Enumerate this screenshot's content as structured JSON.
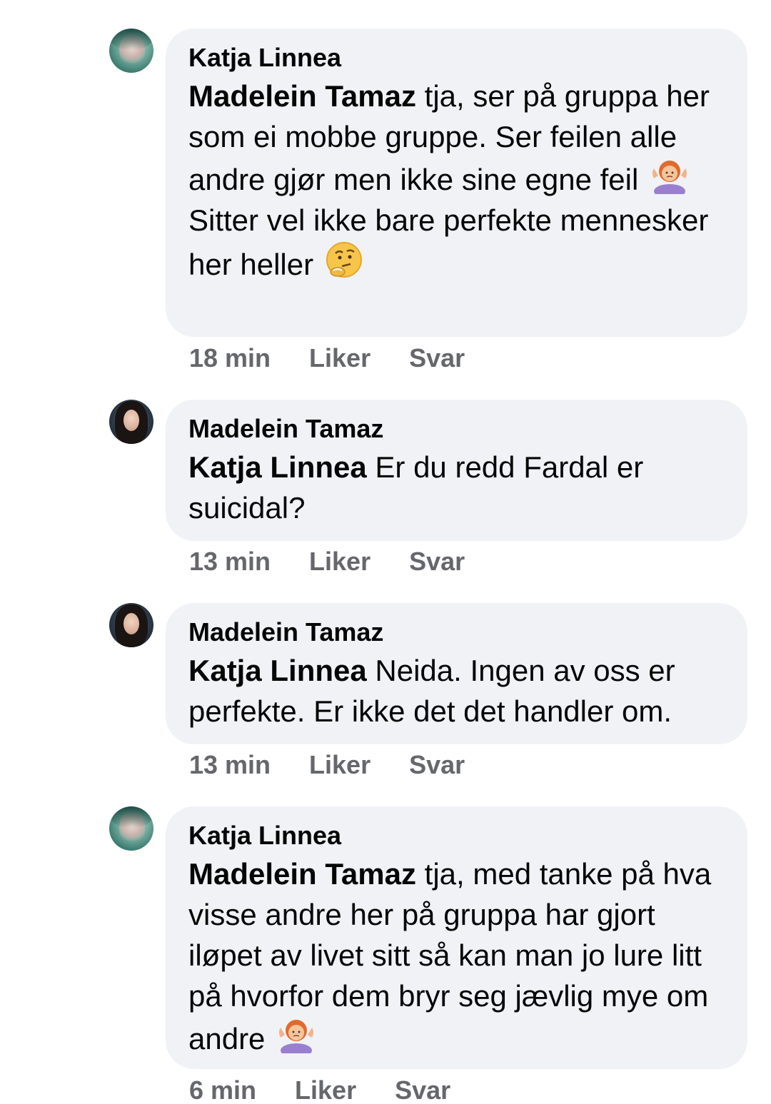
{
  "comments": [
    {
      "author": "Katja Linnea",
      "mention": "Madelein Tamaz",
      "text_line1": " tja, ser på gruppa her som ei mobbe gruppe. Ser feilen alle andre gjør men ikke sine egne feil ",
      "emoji1": "person-shrugging-emoji",
      "text_line2": "Sitter vel ikke bare perfekte mennesker her heller ",
      "emoji2": "thinking-face-emoji",
      "time": "18 min",
      "like_label": "Liker",
      "reply_label": "Svar"
    },
    {
      "author": "Madelein Tamaz",
      "mention": "Katja Linnea",
      "text": " Er du redd Fardal er suicidal?",
      "time": "13 min",
      "like_label": "Liker",
      "reply_label": "Svar"
    },
    {
      "author": "Madelein Tamaz",
      "mention": "Katja Linnea",
      "text": " Neida. Ingen av oss er perfekte. Er ikke det det handler om.",
      "time": "13 min",
      "like_label": "Liker",
      "reply_label": "Svar"
    },
    {
      "author": "Katja Linnea",
      "mention": "Madelein Tamaz",
      "text": " tja, med tanke på hva visse andre her på gruppa har gjort iløpet av livet sitt så kan man jo lure litt på hvorfor dem bryr seg jævlig mye om andre ",
      "emoji1": "person-shrugging-emoji",
      "time": "6 min",
      "like_label": "Liker",
      "reply_label": "Svar"
    }
  ],
  "colors": {
    "bubble": "#f0f2f5",
    "meta_text": "#65676b",
    "text": "#050505"
  }
}
